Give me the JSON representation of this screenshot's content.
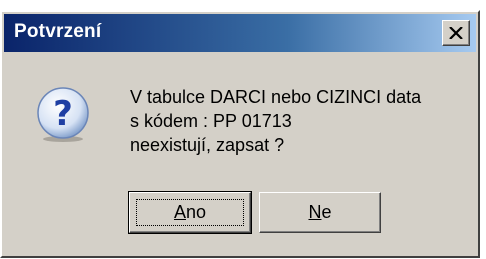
{
  "dialog": {
    "title": "Potvrzení",
    "message_lines": [
      "V tabulce DARCI nebo CIZINCI data",
      "s kódem : PP 01713",
      "neexistují, zapsat ?"
    ],
    "icon": "question-icon",
    "buttons": {
      "yes": {
        "mnemonic": "A",
        "rest": "no"
      },
      "no": {
        "mnemonic": "N",
        "rest": "e"
      }
    }
  },
  "colors": {
    "title_gradient_start": "#0a246a",
    "title_gradient_end": "#a6caf0",
    "face": "#d4d0c8"
  }
}
